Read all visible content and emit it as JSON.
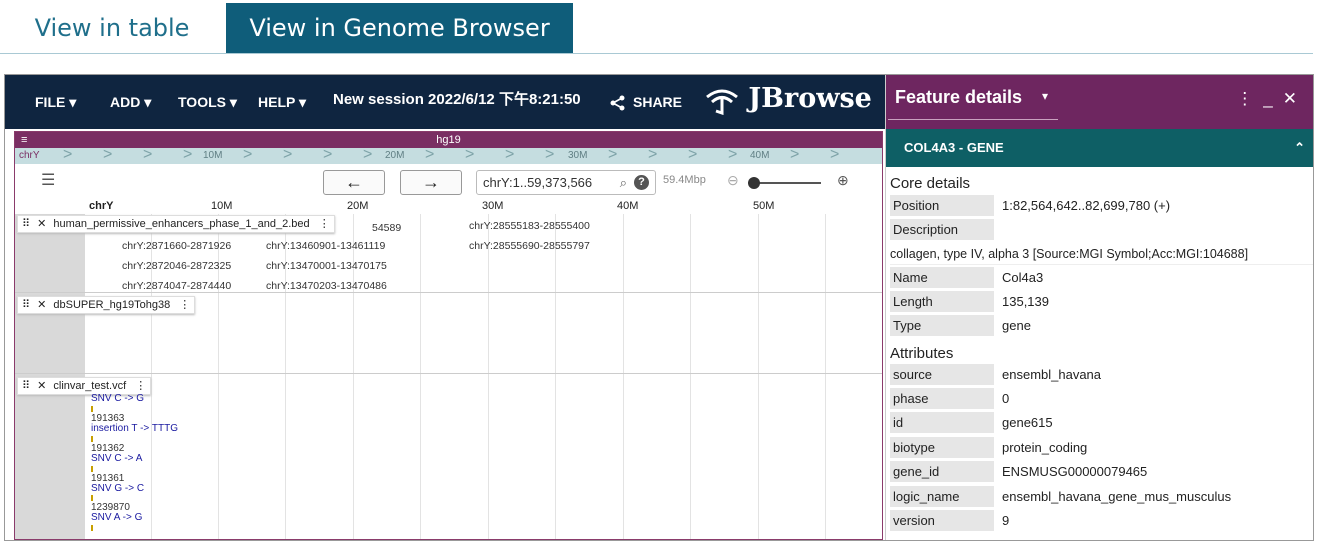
{
  "tabs": {
    "table": "View in table",
    "genome": "View in Genome Browser"
  },
  "menu": {
    "file": "FILE",
    "add": "ADD",
    "tools": "TOOLS",
    "help": "HELP",
    "session": "New session 2022/6/12 下午8:21:50",
    "share": "SHARE",
    "logo": "JBrowse"
  },
  "view": {
    "assembly": "hg19",
    "overview_ref": "chrY",
    "overview_ticks": [
      "10M",
      "20M",
      "30M",
      "40M"
    ],
    "location": "chrY:1..59,373,566",
    "scale": "59.4Mbp",
    "ruler_ref": "chrY",
    "ruler_ticks": [
      "10M",
      "20M",
      "30M",
      "40M",
      "50M"
    ]
  },
  "tracks": {
    "enhancers": {
      "label": "human_permissive_enhancers_phase_1_and_2.bed",
      "features": [
        "chrY:2871660-2871926",
        "chrY:2872046-2872325",
        "chrY:2874047-2874440",
        "chrY:13460901-13461119",
        "chrY:13470001-13470175",
        "chrY:13470203-13470486",
        "chrY:28555183-28555400",
        "chrY:28555690-28555797",
        "54589"
      ]
    },
    "dbsuper": {
      "label": "dbSUPER_hg19Tohg38"
    },
    "clinvar": {
      "label": "clinvar_test.vcf",
      "variants": [
        {
          "pos": "",
          "desc": "SNV C -> G"
        },
        {
          "pos": "191363",
          "desc": "insertion T -> TTTG"
        },
        {
          "pos": "191362",
          "desc": "SNV C -> A"
        },
        {
          "pos": "191361",
          "desc": "SNV G -> C"
        },
        {
          "pos": "1239870",
          "desc": "SNV A -> G"
        }
      ]
    }
  },
  "panel": {
    "title": "Feature details",
    "gene_header": "COL4A3 - GENE",
    "core_title": "Core details",
    "core": {
      "position_k": "Position",
      "position_v": "1:82,564,642..82,699,780 (+)",
      "description_k": "Description",
      "description_v": "collagen, type IV, alpha 3 [Source:MGI Symbol;Acc:MGI:104688]",
      "name_k": "Name",
      "name_v": "Col4a3",
      "length_k": "Length",
      "length_v": "135,139",
      "type_k": "Type",
      "type_v": "gene"
    },
    "attr_title": "Attributes",
    "attrs": {
      "source_k": "source",
      "source_v": "ensembl_havana",
      "phase_k": "phase",
      "phase_v": "0",
      "id_k": "id",
      "id_v": "gene615",
      "biotype_k": "biotype",
      "biotype_v": "protein_coding",
      "gene_id_k": "gene_id",
      "gene_id_v": "ENSMUSG00000079465",
      "logic_name_k": "logic_name",
      "logic_name_v": "ensembl_havana_gene_mus_musculus",
      "version_k": "version",
      "version_v": "9"
    }
  }
}
